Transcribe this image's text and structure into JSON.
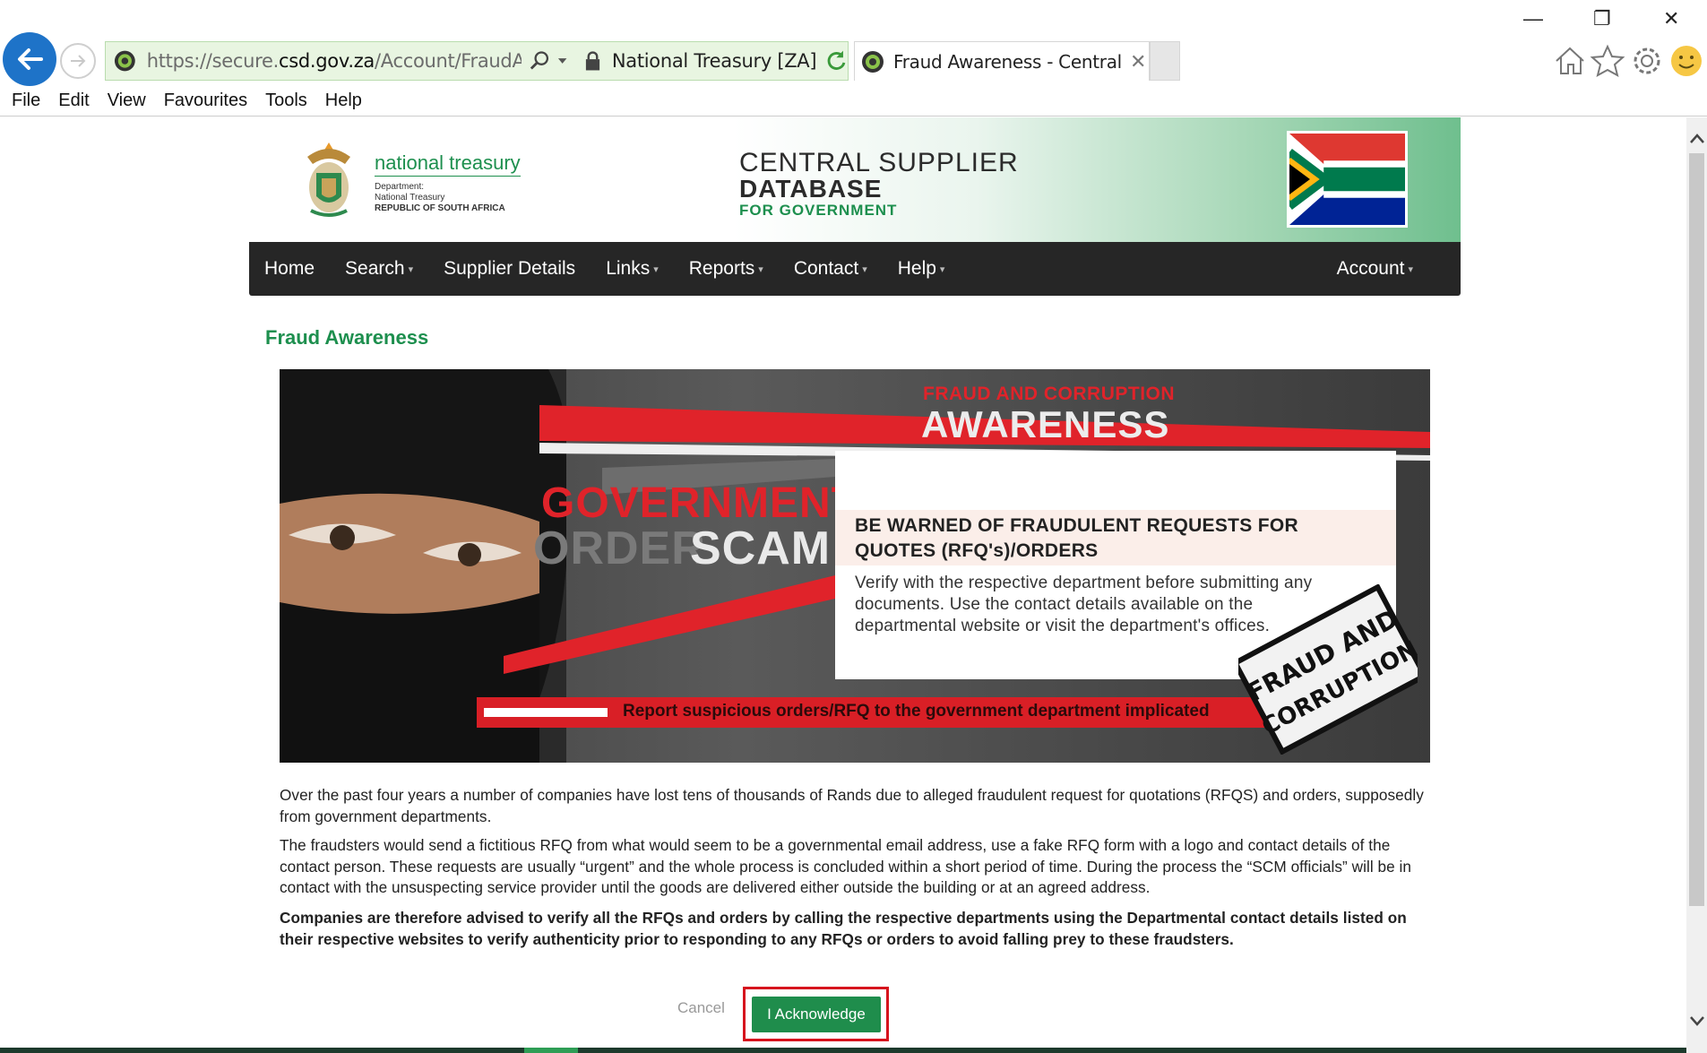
{
  "browser": {
    "url_prefix": "https://secure.",
    "url_domain": "csd.gov.za",
    "url_path": "/Account/FraudAwareness",
    "cert_label": "National Treasury [ZA]",
    "tab_title": "Fraud Awareness - Central S...",
    "tab_close": "✕",
    "window_controls": {
      "minimize": "—",
      "restore": "❐",
      "close": "✕"
    },
    "menu": [
      "File",
      "Edit",
      "View",
      "Favourites",
      "Tools",
      "Help"
    ]
  },
  "header": {
    "treasury_name": "national treasury",
    "treasury_dept_line1": "Department:",
    "treasury_dept_line2": "National Treasury",
    "treasury_country": "REPUBLIC OF SOUTH AFRICA",
    "csd_line1": "CENTRAL SUPPLIER",
    "csd_line2": "DATABASE",
    "csd_line3": "FOR GOVERNMENT"
  },
  "nav": {
    "items": [
      {
        "label": "Home",
        "dropdown": false
      },
      {
        "label": "Search",
        "dropdown": true
      },
      {
        "label": "Supplier Details",
        "dropdown": false
      },
      {
        "label": "Links",
        "dropdown": true
      },
      {
        "label": "Reports",
        "dropdown": true
      },
      {
        "label": "Contact",
        "dropdown": true
      },
      {
        "label": "Help",
        "dropdown": true
      }
    ],
    "account": "Account",
    "caret": "▾"
  },
  "page": {
    "title": "Fraud Awareness",
    "banner": {
      "heading_small": "FRAUD AND CORRUPTION",
      "heading_large": "AWARENESS",
      "scam_line1": "GOVERNMENT",
      "scam_line2a": "ORDER",
      "scam_line2b": "SCAM",
      "box_title": "BE WARNED OF FRAUDULENT REQUESTS FOR QUOTES (RFQ's)/ORDERS",
      "box_body": "Verify with the respective department before submitting any documents. Use the contact details available on the departmental website or visit the department's offices.",
      "report": "Report suspicious orders/RFQ to the government department implicated",
      "stamp_line1": "FRAUD AND",
      "stamp_line2": "CORRUPTION"
    },
    "paragraph1": "Over the past four years a number of companies have lost tens of thousands of Rands due to alleged fraudulent request for quotations (RFQS) and orders, supposedly from government departments.",
    "paragraph2": "The fraudsters would send a fictitious RFQ from what would seem to be a governmental email address, use a fake RFQ form with a logo and contact details of the contact person. These requests are usually “urgent” and the whole process is concluded within a short period of time. During the process the “SCM officials” will be in contact with the unsuspecting service provider until the goods are delivered either outside the building or at an agreed address.",
    "paragraph3": "Companies are therefore advised to verify all the RFQs and orders by calling the respective departments using the Departmental contact details listed on their respective websites to verify authenticity prior to responding to any RFQs or orders to avoid falling prey to these fraudsters.",
    "cancel_label": "Cancel",
    "acknowledge_label": "I Acknowledge"
  },
  "colors": {
    "brand_green": "#1d8f4e",
    "navbar": "#262626",
    "fraud_red": "#e0232a",
    "highlight_red": "#d6141d",
    "address_bar": "#e8f5e1"
  }
}
